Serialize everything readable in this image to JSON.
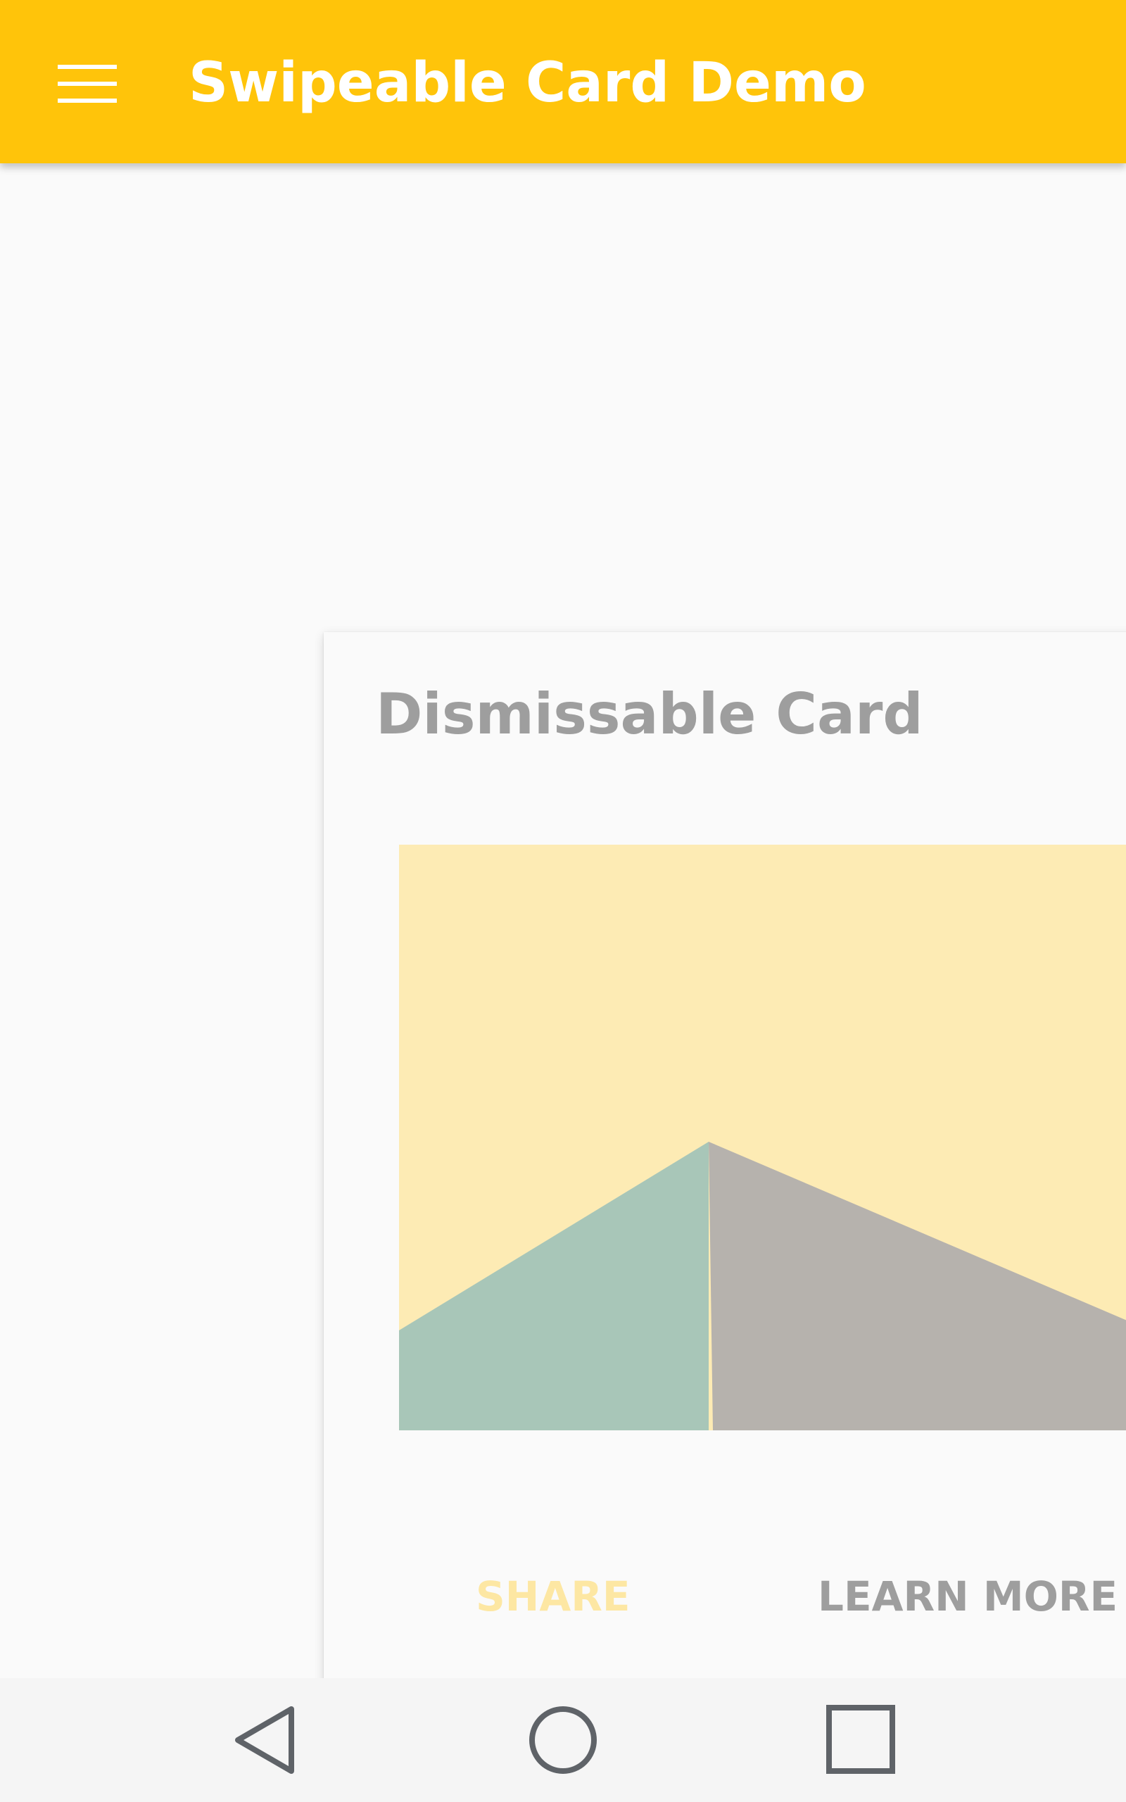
{
  "app_bar": {
    "title": "Swipeable Card Demo",
    "background_color": "#ffc40a",
    "menu_icon": "hamburger-menu-icon"
  },
  "card": {
    "title": "Dismissable Card",
    "image": {
      "description_icon": "landscape-illustration",
      "sky_color": "#fdebb4",
      "left_hill_color": "#a8c6b8",
      "right_hill_color": "#b6b2ad"
    },
    "actions": {
      "share_label": "SHARE",
      "share_color": "#fde7a3",
      "learn_more_label": "LEARN MORE",
      "learn_more_color": "#9e9e9e"
    }
  },
  "nav_bar": {
    "back_icon": "back-triangle-icon",
    "home_icon": "home-circle-icon",
    "recents_icon": "recents-square-icon",
    "icon_color": "#5f6368"
  }
}
